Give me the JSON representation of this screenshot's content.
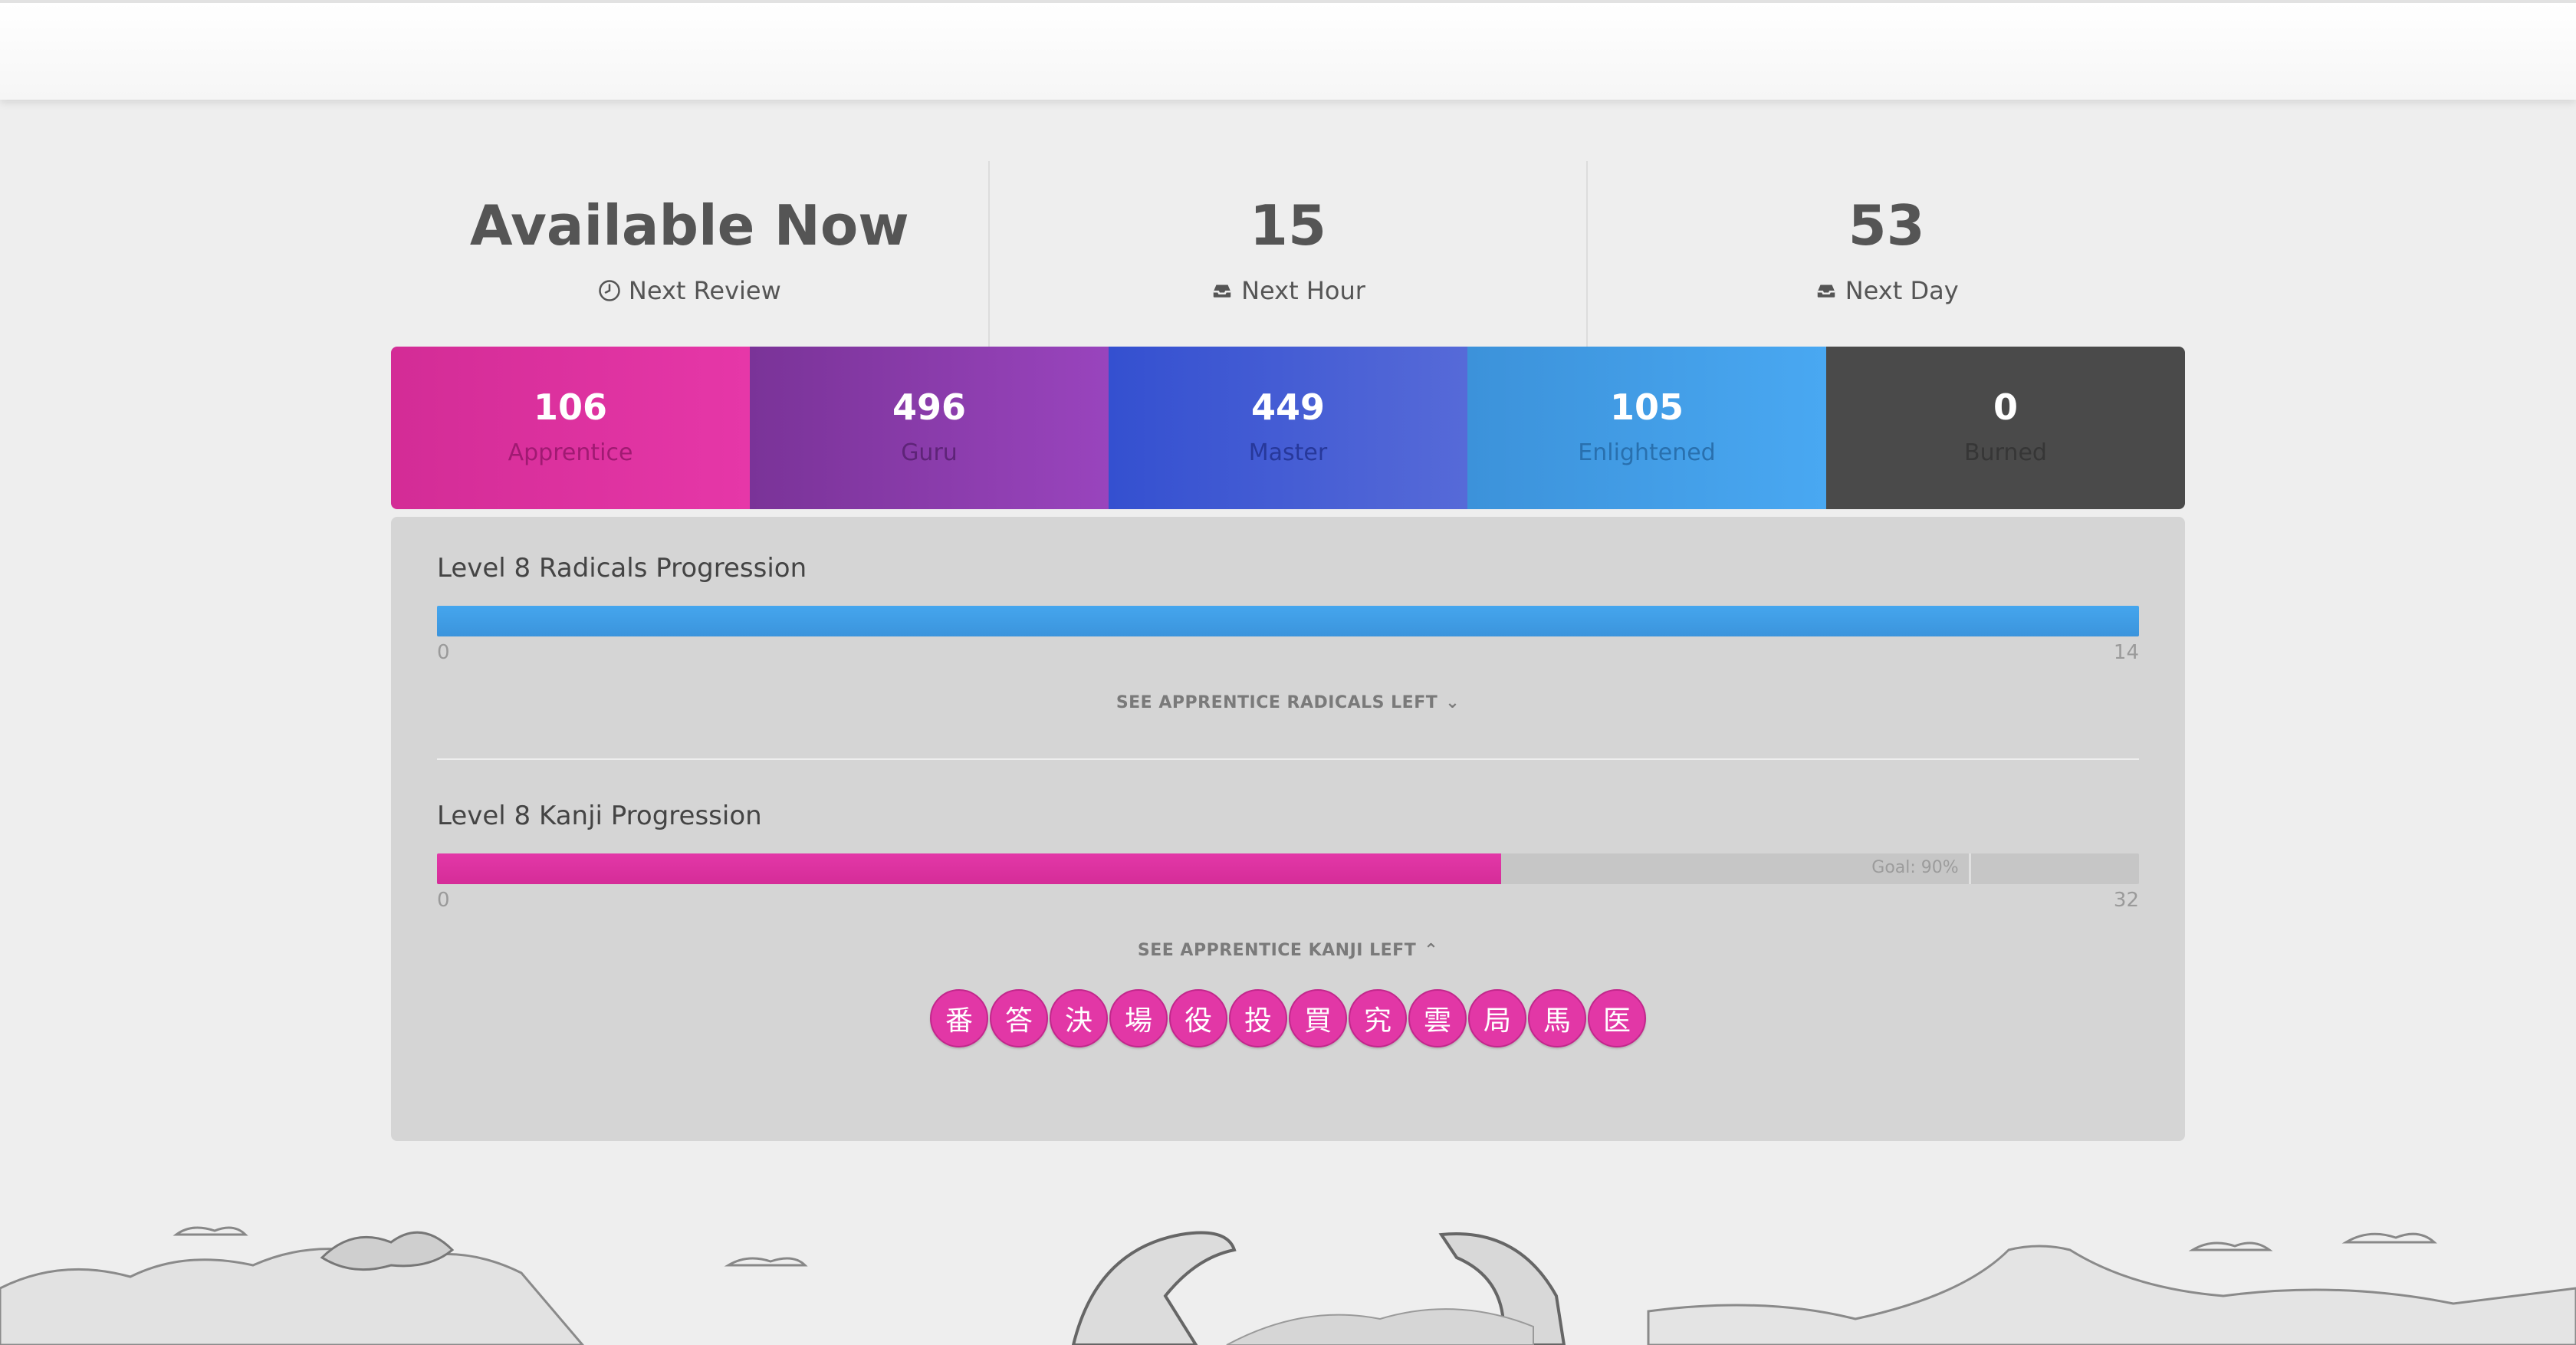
{
  "forecast": [
    {
      "main": "Available Now",
      "sub": "Next Review",
      "icon": "clock-icon"
    },
    {
      "main": "15",
      "sub": "Next Hour",
      "icon": "inbox-icon"
    },
    {
      "main": "53",
      "sub": "Next Day",
      "icon": "inbox-icon"
    }
  ],
  "srs": [
    {
      "count": "106",
      "label": "Apprentice",
      "color": "#e035a5"
    },
    {
      "count": "496",
      "label": "Guru",
      "color": "#8c3fb0"
    },
    {
      "count": "449",
      "label": "Master",
      "color": "#4560d6"
    },
    {
      "count": "105",
      "label": "Enlightened",
      "color": "#44a0ea"
    },
    {
      "count": "0",
      "label": "Burned",
      "color": "#4a4a4a"
    }
  ],
  "radicals": {
    "title": "Level 8 Radicals Progression",
    "min": "0",
    "max": "14",
    "progress": 1.0,
    "toggle_label": "SEE APPRENTICE RADICALS LEFT"
  },
  "kanji": {
    "title": "Level 8 Kanji Progression",
    "min": "0",
    "max": "32",
    "progress": 0.625,
    "goal_label": "Goal: 90%",
    "goal": 0.9,
    "toggle_label": "SEE APPRENTICE KANJI LEFT",
    "items": [
      "番",
      "答",
      "決",
      "場",
      "役",
      "投",
      "買",
      "究",
      "雲",
      "局",
      "馬",
      "医"
    ]
  }
}
